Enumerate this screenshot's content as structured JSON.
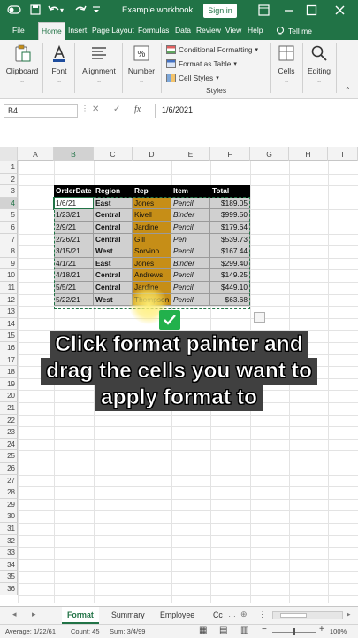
{
  "window": {
    "title": "Example workbook...",
    "signin_label": "Sign in"
  },
  "menu": {
    "tabs": [
      "File",
      "Home",
      "Insert",
      "Page Layout",
      "Formulas",
      "Data",
      "Review",
      "View",
      "Help"
    ],
    "active_tab": "Home",
    "tell_me": "Tell me"
  },
  "ribbon": {
    "clipboard": "Clipboard",
    "font": "Font",
    "alignment": "Alignment",
    "number": "Number",
    "conditional_formatting": "Conditional Formatting",
    "format_as_table": "Format as Table",
    "cell_styles": "Cell Styles",
    "styles_group": "Styles",
    "cells": "Cells",
    "editing": "Editing"
  },
  "formula_bar": {
    "name_box": "B4",
    "fx_label": "fx",
    "value": "1/6/2021"
  },
  "grid": {
    "columns": [
      "A",
      "B",
      "C",
      "D",
      "E",
      "F",
      "G",
      "H",
      "I"
    ],
    "rows": [
      "1",
      "2",
      "3",
      "4",
      "5",
      "6",
      "7",
      "8",
      "9",
      "10",
      "11",
      "12",
      "13",
      "14",
      "15",
      "16",
      "17",
      "18",
      "19",
      "20",
      "21",
      "22",
      "23",
      "24",
      "25",
      "26",
      "27",
      "28",
      "29",
      "30",
      "31",
      "32",
      "33",
      "34",
      "35",
      "36"
    ],
    "selected_column": "B",
    "selected_row": "4"
  },
  "table": {
    "headers": [
      "OrderDate",
      "Region",
      "Rep",
      "Item",
      "Total"
    ],
    "rows": [
      [
        "1/6/21",
        "East",
        "Jones",
        "Pencil",
        "$189.05"
      ],
      [
        "1/23/21",
        "Central",
        "Kivell",
        "Binder",
        "$999.50"
      ],
      [
        "2/9/21",
        "Central",
        "Jardine",
        "Pencil",
        "$179.64"
      ],
      [
        "2/26/21",
        "Central",
        "Gill",
        "Pen",
        "$539.73"
      ],
      [
        "3/15/21",
        "West",
        "Sorvino",
        "Pencil",
        "$167.44"
      ],
      [
        "4/1/21",
        "East",
        "Jones",
        "Binder",
        "$299.40"
      ],
      [
        "4/18/21",
        "Central",
        "Andrews",
        "Pencil",
        "$149.25"
      ],
      [
        "5/5/21",
        "Central",
        "Jardine",
        "Pencil",
        "$449.10"
      ],
      [
        "5/22/21",
        "West",
        "Thompson",
        "Pencil",
        "$63.68"
      ]
    ]
  },
  "caption": {
    "line1": "Click format painter and",
    "line2": "drag the cells you want to",
    "line3": "apply format to"
  },
  "sheets": {
    "tabs": [
      "Format",
      "Summary",
      "Employee",
      "Cc"
    ],
    "active": "Format"
  },
  "status": {
    "average": "Average: 1/22/61",
    "count": "Count: 45",
    "sum": "Sum: 3/4/99",
    "zoom": "100%"
  },
  "colors": {
    "accent": "#217346",
    "rep_fill": "#c68e17",
    "data_fill": "#d0d0d0",
    "check_green": "#22b14c"
  }
}
